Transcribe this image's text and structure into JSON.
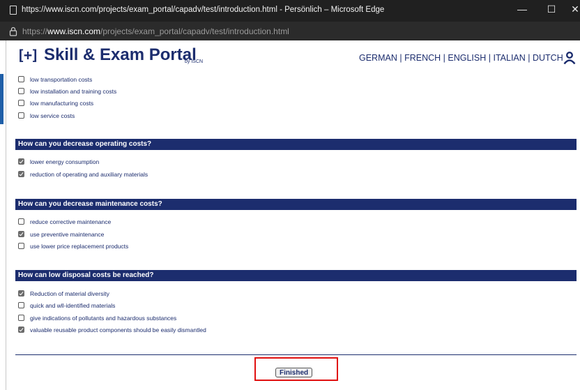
{
  "browser": {
    "window_title": "https://www.iscn.com/projects/exam_portal/capadv/test/introduction.html - Persönlich – Microsoft Edge",
    "url_prefix": "https://",
    "url_host": "www.iscn.com",
    "url_path": "/projects/exam_portal/capadv/test/introduction.html",
    "minimize_glyph": "—",
    "maximize_glyph": "☐",
    "close_glyph": "✕"
  },
  "header": {
    "logo_bracket": "[+]",
    "logo_text": "Skill & Exam Portal",
    "logo_by": "by ISCN",
    "languages": [
      "GERMAN",
      "FRENCH",
      "ENGLISH",
      "ITALIAN",
      "DUTCH"
    ],
    "language_separator": " | ",
    "user_icon": "user-icon"
  },
  "questions": [
    {
      "heading": "",
      "options": [
        {
          "label": "low transportation costs",
          "checked": false
        },
        {
          "label": "low installation and training costs",
          "checked": false
        },
        {
          "label": "low manufacturing costs",
          "checked": false
        },
        {
          "label": "low service costs",
          "checked": false
        }
      ]
    },
    {
      "heading": "How can you decrease operating costs?",
      "options": [
        {
          "label": "lower energy consumption",
          "checked": true
        },
        {
          "label": "reduction of operating and auxiliary materials",
          "checked": true
        }
      ]
    },
    {
      "heading": "How can you decrease maintenance costs?",
      "options": [
        {
          "label": "reduce corrective maintenance",
          "checked": false
        },
        {
          "label": "use preventive maintenance",
          "checked": true
        },
        {
          "label": "use lower price replacement products",
          "checked": false
        }
      ]
    },
    {
      "heading": "How can low disposal costs be reached?",
      "options": [
        {
          "label": "Reduction of material diversity",
          "checked": true
        },
        {
          "label": "quick and wll-identified materials",
          "checked": false
        },
        {
          "label": "give indications of pollutants and hazardous substances",
          "checked": false
        },
        {
          "label": "valuable reusable product components should be easily dismantled",
          "checked": true
        }
      ]
    }
  ],
  "footer": {
    "finished_label": "Finished"
  },
  "colors": {
    "brand_navy": "#1c2d6e",
    "highlight_red": "#e01010"
  }
}
